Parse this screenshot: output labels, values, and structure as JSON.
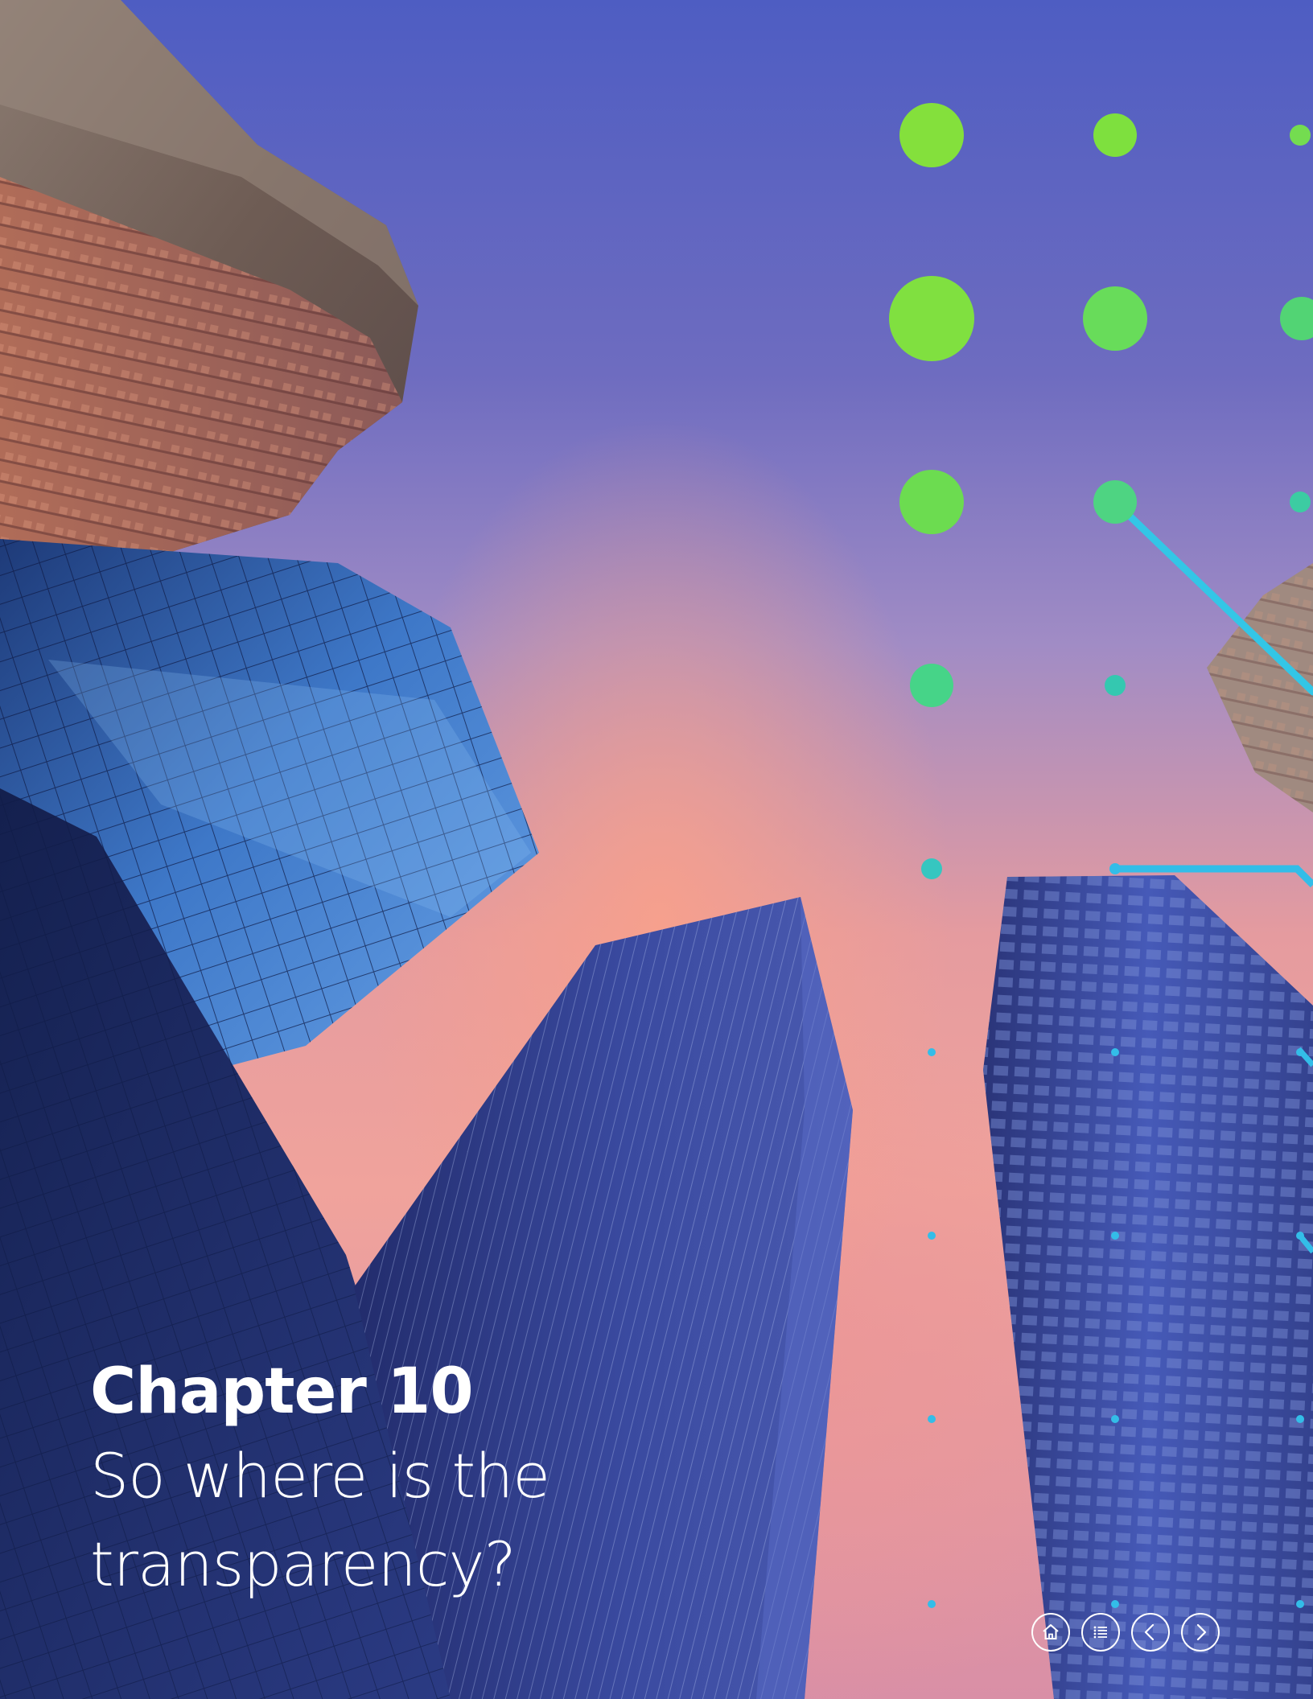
{
  "cover": {
    "chapter_label": "Chapter 10",
    "subtitle": "So where is the transparency?"
  },
  "navigation": {
    "buttons": [
      {
        "icon": "home-icon"
      },
      {
        "icon": "list-icon"
      },
      {
        "icon": "chevron-left-icon"
      },
      {
        "icon": "chevron-right-icon"
      }
    ]
  },
  "colors": {
    "sky_top": "#4e5dc2",
    "sky_glow": "#f0a39c",
    "dot_green": "#7ee03e",
    "dot_teal": "#3ccfa0",
    "dot_cyan": "#33bde8",
    "text": "#ffffff"
  }
}
